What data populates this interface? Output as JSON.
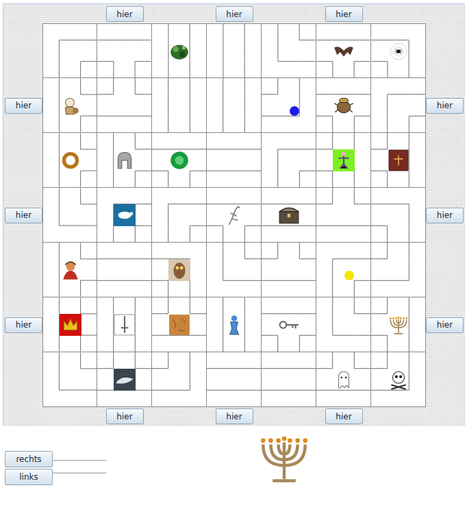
{
  "board": {
    "top_buttons": [
      {
        "label": "hier"
      },
      {
        "label": "hier"
      },
      {
        "label": "hier"
      }
    ],
    "bottom_buttons": [
      {
        "label": "hier"
      },
      {
        "label": "hier"
      },
      {
        "label": "hier"
      }
    ],
    "left_buttons": [
      {
        "label": "hier"
      },
      {
        "label": "hier"
      },
      {
        "label": "hier"
      }
    ],
    "right_buttons": [
      {
        "label": "hier"
      },
      {
        "label": "hier"
      },
      {
        "label": "hier"
      }
    ],
    "rows": [
      {
        "tiles": [
          {
            "kind": "ES",
            "treasure": null,
            "pawn": null
          },
          {
            "kind": "ESW",
            "treasure": null,
            "pawn": null
          },
          {
            "kind": "NS",
            "treasure": "dragon",
            "pawn": null
          },
          {
            "kind": "NS",
            "treasure": null,
            "pawn": null
          },
          {
            "kind": "NE",
            "treasure": null,
            "pawn": null
          },
          {
            "kind": "ESW",
            "treasure": "bat",
            "pawn": null
          },
          {
            "kind": "SW",
            "treasure": "spider",
            "pawn": null
          }
        ]
      },
      {
        "tiles": [
          {
            "kind": "NES",
            "treasure": "gnome",
            "pawn": null
          },
          {
            "kind": "NEW",
            "treasure": null,
            "pawn": null
          },
          {
            "kind": "NS",
            "treasure": null,
            "pawn": null
          },
          {
            "kind": "NS",
            "treasure": null,
            "pawn": null
          },
          {
            "kind": "NW",
            "treasure": null,
            "pawn": {
              "color": "#1c1ce8"
            }
          },
          {
            "kind": "ESW",
            "treasure": "scarab",
            "pawn": null
          },
          {
            "kind": "ES",
            "treasure": null,
            "pawn": null
          }
        ]
      },
      {
        "tiles": [
          {
            "kind": "NES",
            "treasure": "ring",
            "pawn": null
          },
          {
            "kind": "NES",
            "treasure": "helmet",
            "pawn": null
          },
          {
            "kind": "ESW",
            "treasure": "emerald",
            "pawn": null
          },
          {
            "kind": "EW",
            "treasure": null,
            "pawn": null
          },
          {
            "kind": "ES",
            "treasure": null,
            "pawn": null
          },
          {
            "kind": "NSW",
            "treasure": "fairy",
            "pawn": null
          },
          {
            "kind": "NSW",
            "treasure": "book",
            "pawn": null
          }
        ]
      },
      {
        "tiles": [
          {
            "kind": "NE",
            "treasure": null,
            "pawn": null
          },
          {
            "kind": "ES",
            "treasure": "sheep",
            "pawn": null
          },
          {
            "kind": "ES",
            "treasure": null,
            "pawn": null
          },
          {
            "kind": "ESW",
            "treasure": "lizard",
            "pawn": null
          },
          {
            "kind": "EW",
            "treasure": "chest",
            "pawn": null
          },
          {
            "kind": "NEW",
            "treasure": null,
            "pawn": null
          },
          {
            "kind": "SW",
            "treasure": null,
            "pawn": null
          }
        ]
      },
      {
        "tiles": [
          {
            "kind": "NES",
            "treasure": "genie",
            "pawn": null
          },
          {
            "kind": "EW",
            "treasure": null,
            "pawn": null
          },
          {
            "kind": "SW",
            "treasure": "owl",
            "pawn": null
          },
          {
            "kind": "NE",
            "treasure": null,
            "pawn": null
          },
          {
            "kind": "NEW",
            "treasure": null,
            "pawn": null
          },
          {
            "kind": "ES",
            "treasure": null,
            "pawn": {
              "color": "#f2e600"
            }
          },
          {
            "kind": "NW",
            "treasure": null,
            "pawn": null
          }
        ]
      },
      {
        "tiles": [
          {
            "kind": "NES",
            "treasure": "crown",
            "pawn": null
          },
          {
            "kind": "NS",
            "treasure": "sword",
            "pawn": null
          },
          {
            "kind": "NEW",
            "treasure": "map",
            "pawn": null
          },
          {
            "kind": "NS",
            "treasure": "idol",
            "pawn": null
          },
          {
            "kind": "ESW",
            "treasure": "key",
            "pawn": null
          },
          {
            "kind": "NE",
            "treasure": null,
            "pawn": null
          },
          {
            "kind": "NSW",
            "treasure": "menorah",
            "pawn": null
          }
        ]
      },
      {
        "tiles": [
          {
            "kind": "NE",
            "treasure": null,
            "pawn": null
          },
          {
            "kind": "NEW",
            "treasure": "bird",
            "pawn": null
          },
          {
            "kind": "NW",
            "treasure": null,
            "pawn": null
          },
          {
            "kind": "EW",
            "treasure": null,
            "pawn": null
          },
          {
            "kind": "EW",
            "treasure": null,
            "pawn": null
          },
          {
            "kind": "NEW",
            "treasure": "ghost",
            "pawn": null
          },
          {
            "kind": "NW",
            "treasure": "skull",
            "pawn": null
          }
        ]
      }
    ]
  },
  "controls": {
    "buttons": [
      {
        "label": "rechts"
      },
      {
        "label": "links"
      }
    ],
    "spare_tile": {
      "kind": "EW"
    }
  },
  "target": {
    "treasure": "menorah"
  }
}
